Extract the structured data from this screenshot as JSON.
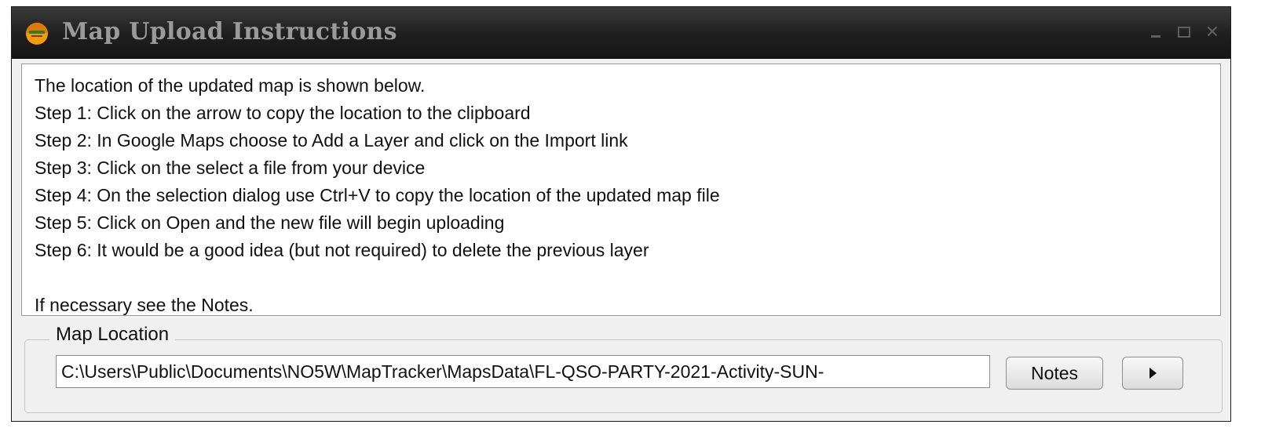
{
  "window": {
    "title": "Map Upload Instructions",
    "controls": {
      "close_glyph": "✕"
    }
  },
  "instructions": {
    "lines": [
      "The location of the updated map is shown below.",
      "Step 1: Click on the arrow to copy the location to the clipboard",
      "Step 2: In Google Maps choose to Add a Layer and click on the Import link",
      "Step 3: Click on the select a file from your device",
      "Step 4: On the selection dialog use Ctrl+V to copy the location of the updated map file",
      "Step 5: Click on Open and the new file will begin uploading",
      "Step 6: It would be a good idea (but not required) to delete the previous layer",
      "",
      "If necessary see the Notes."
    ]
  },
  "map_location": {
    "legend": "Map Location",
    "path_value": "C:\\Users\\Public\\Documents\\NO5W\\MapTracker\\MapsData\\FL-QSO-PARTY-2021-Activity-SUN-",
    "notes_label": "Notes",
    "copy_icon": "play-arrow-icon"
  },
  "colors": {
    "titlebar": "#1e1e1e",
    "title_text": "#9a9a9a",
    "dialog_bg": "#f0f0f0"
  }
}
